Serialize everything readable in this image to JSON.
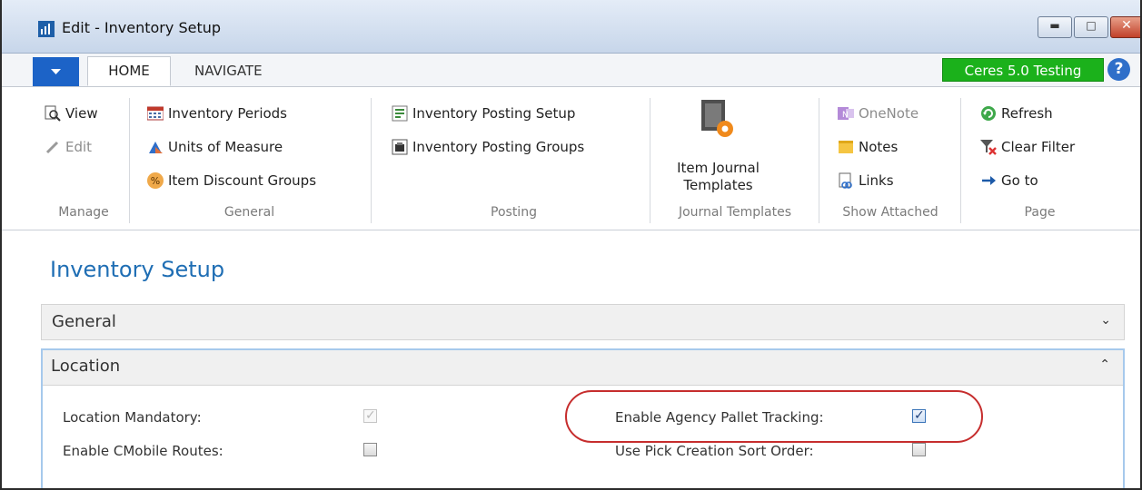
{
  "window": {
    "title": "Edit - Inventory Setup"
  },
  "tabs": {
    "home": "HOME",
    "navigate": "NAVIGATE"
  },
  "company_badge": "Ceres 5.0 Testing",
  "help_glyph": "?",
  "ribbon": {
    "manage": {
      "label": "Manage",
      "view": "View",
      "edit": "Edit"
    },
    "general": {
      "label": "General",
      "inventory_periods": "Inventory Periods",
      "units_of_measure": "Units of Measure",
      "item_discount_groups": "Item Discount Groups"
    },
    "posting": {
      "label": "Posting",
      "inventory_posting_setup": "Inventory Posting Setup",
      "inventory_posting_groups": "Inventory Posting Groups"
    },
    "journal_templates": {
      "label": "Journal Templates",
      "item_journal_line1": "Item Journal",
      "item_journal_line2": "Templates"
    },
    "show_attached": {
      "label": "Show Attached",
      "onenote": "OneNote",
      "notes": "Notes",
      "links": "Links"
    },
    "page": {
      "label": "Page",
      "refresh": "Refresh",
      "clear_filter": "Clear Filter",
      "go_to": "Go to"
    }
  },
  "content": {
    "page_title": "Inventory Setup",
    "fasttab_general": "General",
    "fasttab_location": "Location",
    "fields": {
      "location_mandatory": {
        "label": "Location Mandatory:",
        "checked": true,
        "editable": false
      },
      "enable_cmobile_routes": {
        "label": "Enable CMobile Routes:",
        "checked": false
      },
      "enable_agency_pallet_tracking": {
        "label": "Enable Agency Pallet Tracking:",
        "checked": true
      },
      "use_pick_creation_sort_order": {
        "label": "Use Pick Creation Sort Order:",
        "checked": false
      }
    }
  },
  "colors": {
    "accent": "#1c63c7",
    "title_blue": "#1f6eb4",
    "company_green": "#1bb11b",
    "highlight_red": "#c62d2d"
  },
  "icons": [
    "app-icon",
    "file-menu-arrow-icon",
    "help-icon",
    "view-icon",
    "edit-pencil-icon",
    "calendar-grid-icon",
    "units-icon",
    "percent-icon",
    "posting-setup-icon",
    "posting-groups-icon",
    "journal-templates-icon",
    "onenote-icon",
    "notes-icon",
    "links-icon",
    "refresh-icon",
    "clear-filter-icon",
    "go-to-arrow-icon"
  ]
}
